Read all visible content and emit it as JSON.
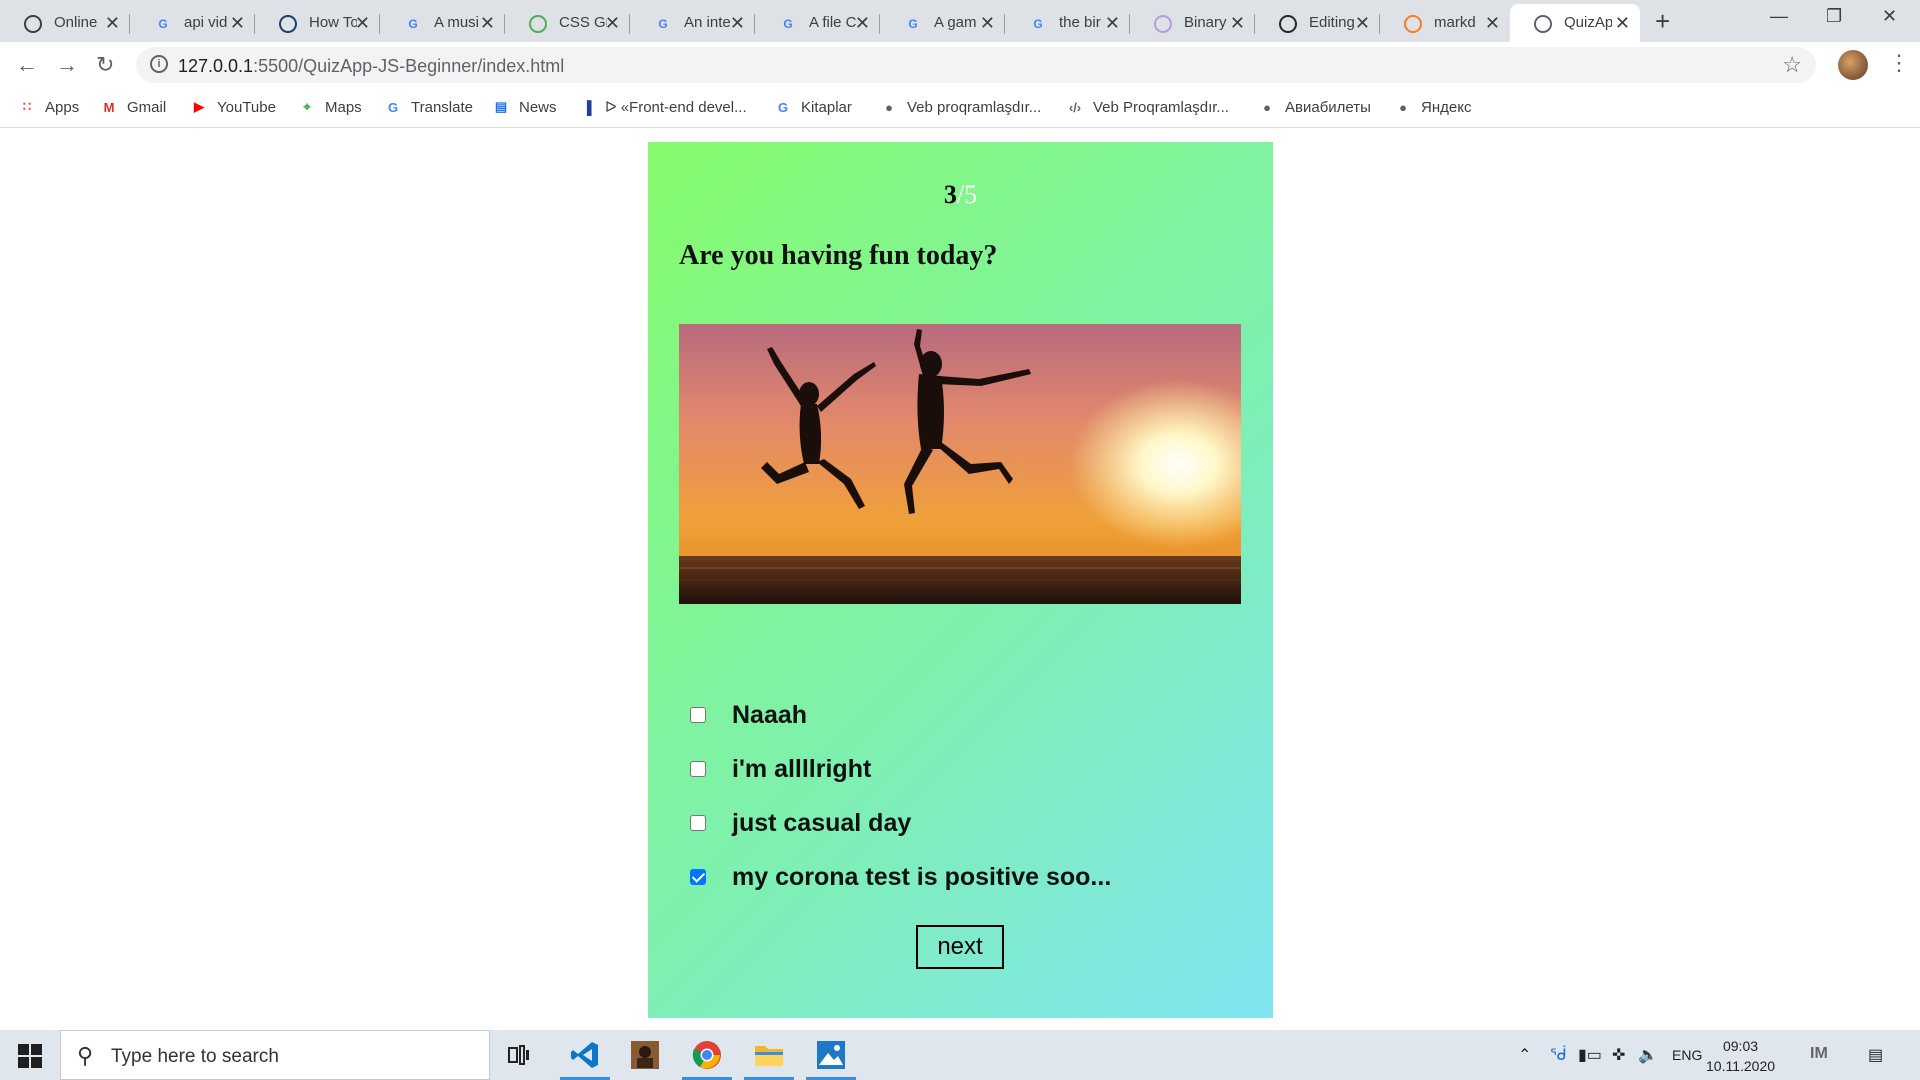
{
  "browser": {
    "tabs": [
      {
        "label": "Online",
        "icon": "circle-t-icon",
        "color": "#3c4043"
      },
      {
        "label": "api vid",
        "icon": "google-icon",
        "color": "#4285f4"
      },
      {
        "label": "How To",
        "icon": "globe-person-icon",
        "color": "#1a3f6f"
      },
      {
        "label": "A musi",
        "icon": "google-icon",
        "color": "#4285f4"
      },
      {
        "label": "CSS Gr",
        "icon": "w3-icon",
        "color": "#4caf50"
      },
      {
        "label": "An inte",
        "icon": "google-icon",
        "color": "#4285f4"
      },
      {
        "label": "A file C",
        "icon": "google-icon",
        "color": "#4285f4"
      },
      {
        "label": "A gam",
        "icon": "google-icon",
        "color": "#4285f4"
      },
      {
        "label": "the bir",
        "icon": "google-icon",
        "color": "#4285f4"
      },
      {
        "label": "Binary",
        "icon": "binary-icon",
        "color": "#b39ddb"
      },
      {
        "label": "Editing",
        "icon": "github-icon",
        "color": "#24292e"
      },
      {
        "label": "markd",
        "icon": "stackoverflow-icon",
        "color": "#f48024"
      },
      {
        "label": "QuizAp",
        "icon": "globe-icon",
        "color": "#5f6368",
        "active": true
      }
    ],
    "address": {
      "host": "127.0.0.1",
      "path": ":5500/QuizApp-JS-Beginner/index.html"
    },
    "bookmarks": [
      {
        "label": "Apps",
        "icon": "apps-grid-icon",
        "color": "#ea4335"
      },
      {
        "label": "Gmail",
        "icon": "gmail-icon",
        "color": "#d93025"
      },
      {
        "label": "YouTube",
        "icon": "youtube-icon",
        "color": "#ff0000"
      },
      {
        "label": "Maps",
        "icon": "maps-pin-icon",
        "color": "#34a853"
      },
      {
        "label": "Translate",
        "icon": "translate-icon",
        "color": "#4285f4"
      },
      {
        "label": "News",
        "icon": "news-icon",
        "color": "#1a73e8"
      },
      {
        "label": "ᐅ «Front-end devel...",
        "icon": "bar-chart-icon",
        "color": "#1a3f9f"
      },
      {
        "label": "Kitaplar",
        "icon": "google-icon",
        "color": "#4285f4"
      },
      {
        "label": "Veb proqramlaşdır...",
        "icon": "globe-icon",
        "color": "#5f6368"
      },
      {
        "label": "Veb Proqramlaşdır...",
        "icon": "code-icon",
        "color": "#5f6368"
      },
      {
        "label": "Авиабилеты",
        "icon": "globe-icon",
        "color": "#5f6368"
      },
      {
        "label": "Яндекс",
        "icon": "globe-icon",
        "color": "#5f6368"
      }
    ]
  },
  "quiz": {
    "current": "3",
    "total": "/5",
    "question": "Are you having fun today?",
    "image_description_icon": "jumping-silhouettes-sunset-image",
    "answers": [
      {
        "label": "Naaah",
        "checked": false
      },
      {
        "label": "i'm allllright",
        "checked": false
      },
      {
        "label": "just casual day",
        "checked": false
      },
      {
        "label": "my corona test is positive soo...",
        "checked": true
      }
    ],
    "next_label": "next",
    "gradient": [
      "#86fb6c",
      "#80e4f2"
    ]
  },
  "taskbar": {
    "search_placeholder": "Type here to search",
    "language": "ENG",
    "time": "09:03",
    "date": "10.11.2020"
  }
}
